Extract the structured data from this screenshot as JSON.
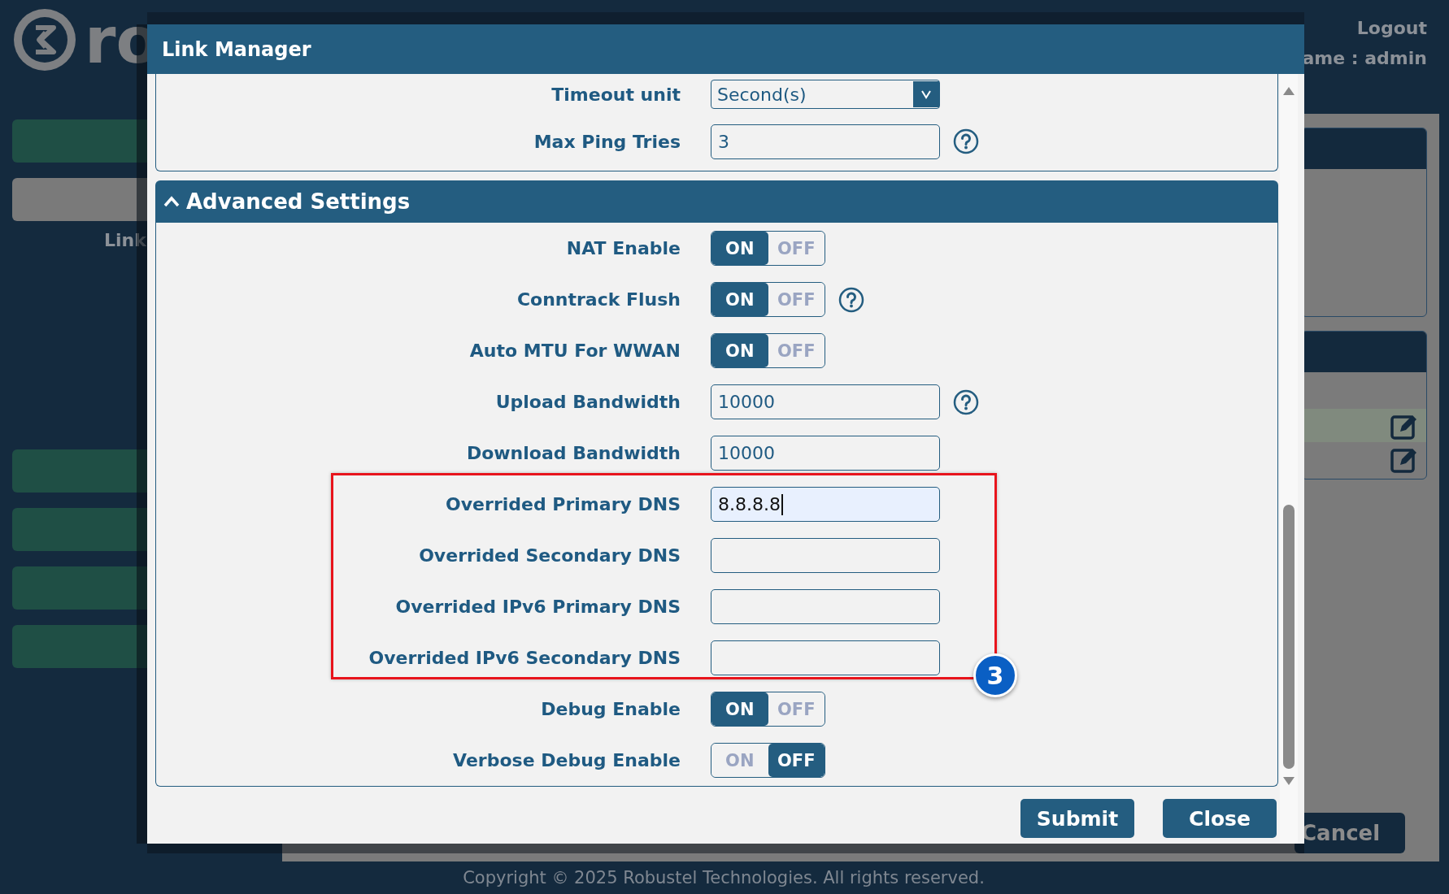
{
  "background": {
    "logo_text": "ro",
    "header_link": "Logout",
    "user_label": "ame : admin",
    "sidebar_caption": "Link",
    "cancel_button": "Cancel",
    "copyright": "Copyright © 2025 Robustel Technologies. All rights reserved."
  },
  "dialog": {
    "title": "Link Manager",
    "top_rows": [
      {
        "label": "Timeout unit",
        "kind": "select",
        "value": "Second(s)",
        "help": false
      },
      {
        "label": "Max Ping Tries",
        "kind": "input",
        "value": "3",
        "help": true
      }
    ],
    "section": {
      "title": "Advanced Settings",
      "expanded": true
    },
    "row_groups": [
      {
        "highlighted": false,
        "rows": [
          {
            "label": "NAT Enable",
            "kind": "toggle",
            "options": [
              "ON",
              "OFF"
            ],
            "on": true,
            "help": false
          },
          {
            "label": "Conntrack Flush",
            "kind": "toggle",
            "options": [
              "ON",
              "OFF"
            ],
            "on": true,
            "help": true
          },
          {
            "label": "Auto MTU For WWAN",
            "kind": "toggle",
            "options": [
              "ON",
              "OFF"
            ],
            "on": true,
            "help": false
          },
          {
            "label": "Upload Bandwidth",
            "kind": "input",
            "value": "10000",
            "help": true,
            "focused": false
          },
          {
            "label": "Download Bandwidth",
            "kind": "input",
            "value": "10000",
            "help": false,
            "focused": false
          }
        ]
      },
      {
        "highlighted": true,
        "badge": "3",
        "rows": [
          {
            "label": "Overrided Primary DNS",
            "kind": "input",
            "value": "8.8.8.8",
            "help": false,
            "focused": true
          },
          {
            "label": "Overrided Secondary DNS",
            "kind": "input",
            "help": false,
            "focused": false
          },
          {
            "label": "Overrided IPv6 Primary DNS",
            "kind": "input",
            "help": false,
            "focused": false
          },
          {
            "label": "Overrided IPv6 Secondary DNS",
            "kind": "input",
            "help": false,
            "focused": false
          }
        ]
      },
      {
        "highlighted": false,
        "rows": [
          {
            "label": "Debug Enable",
            "kind": "toggle",
            "options": [
              "ON",
              "OFF"
            ],
            "on": true,
            "help": false
          },
          {
            "label": "Verbose Debug Enable",
            "kind": "toggle",
            "options": [
              "ON",
              "OFF"
            ],
            "on": false,
            "help": false
          }
        ]
      }
    ],
    "buttons": [
      "Submit",
      "Close"
    ]
  }
}
